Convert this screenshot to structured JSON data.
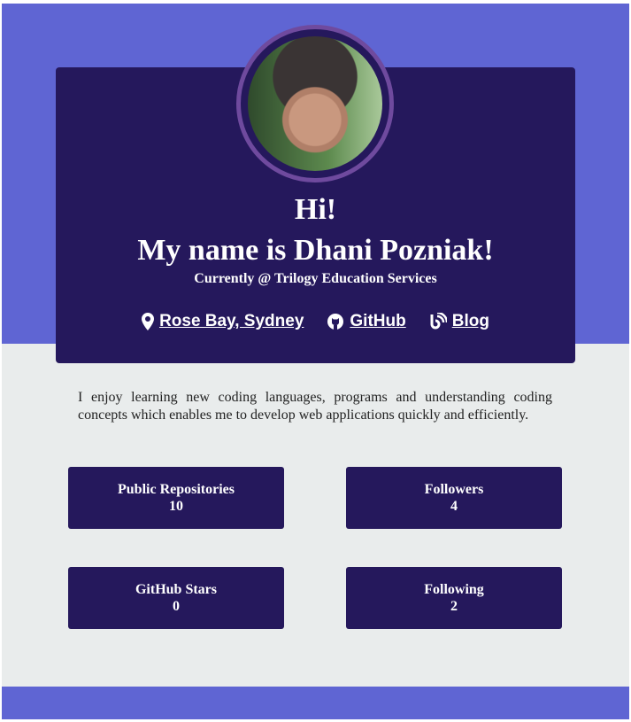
{
  "header": {
    "greeting": "Hi!",
    "name": "My name is Dhani Pozniak!",
    "subtitle": "Currently @ Trilogy Education Services"
  },
  "links": [
    {
      "label": "Rose Bay, Sydney",
      "icon": "map-pin-icon"
    },
    {
      "label": "GitHub",
      "icon": "github-icon"
    },
    {
      "label": "Blog",
      "icon": "rss-icon"
    }
  ],
  "bio": "I enjoy learning new coding languages, programs and understanding coding concepts which enables me to develop web applications quickly and efficiently.",
  "stats": [
    {
      "label": "Public Repositories",
      "value": "10"
    },
    {
      "label": "Followers",
      "value": "4"
    },
    {
      "label": "GitHub Stars",
      "value": "0"
    },
    {
      "label": "Following",
      "value": "2"
    }
  ],
  "colors": {
    "primary": "#5f65d3",
    "card": "#25185c",
    "border": "#6f4a9e",
    "background": "#e9ecec"
  }
}
